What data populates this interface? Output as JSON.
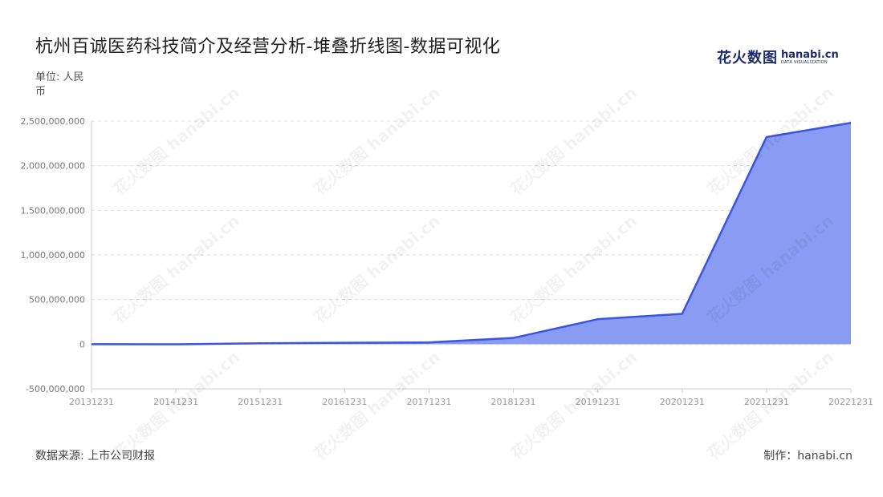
{
  "header": {
    "title": "杭州百诚医药科技简介及经营分析-堆叠折线图-数据可视化",
    "logo_cn": "花火数图",
    "logo_en": "hanabi.cn",
    "logo_en_sub": "DATA VISUALIZATION"
  },
  "unit_label": "单位: 人民币",
  "footer": {
    "source": "数据来源: 上市公司财报",
    "maker": "制作：hanabi.cn"
  },
  "colors": {
    "line": "#3a55e0",
    "area": "#8a9bf3",
    "grid": "#dddddd"
  },
  "chart_data": {
    "type": "area",
    "title": "杭州百诚医药科技简介及经营分析-堆叠折线图-数据可视化",
    "xlabel": "",
    "ylabel": "单位: 人民币",
    "x": [
      "20131231",
      "20141231",
      "20151231",
      "20161231",
      "20171231",
      "20181231",
      "20191231",
      "20201231",
      "20211231",
      "20221231"
    ],
    "series": [
      {
        "name": "",
        "values": [
          0,
          -2000000,
          10000000,
          15000000,
          20000000,
          70000000,
          280000000,
          340000000,
          2320000000,
          2480000000
        ]
      }
    ],
    "ylim": [
      -500000000,
      2500000000
    ],
    "yticks": [
      -500000000,
      0,
      500000000,
      1000000000,
      1500000000,
      2000000000,
      2500000000
    ],
    "ytick_labels": [
      "-500,000,000",
      "0",
      "500,000,000",
      "1,000,000,000",
      "1,500,000,000",
      "2,000,000,000",
      "2,500,000,000"
    ],
    "grid": true,
    "legend": "none"
  }
}
